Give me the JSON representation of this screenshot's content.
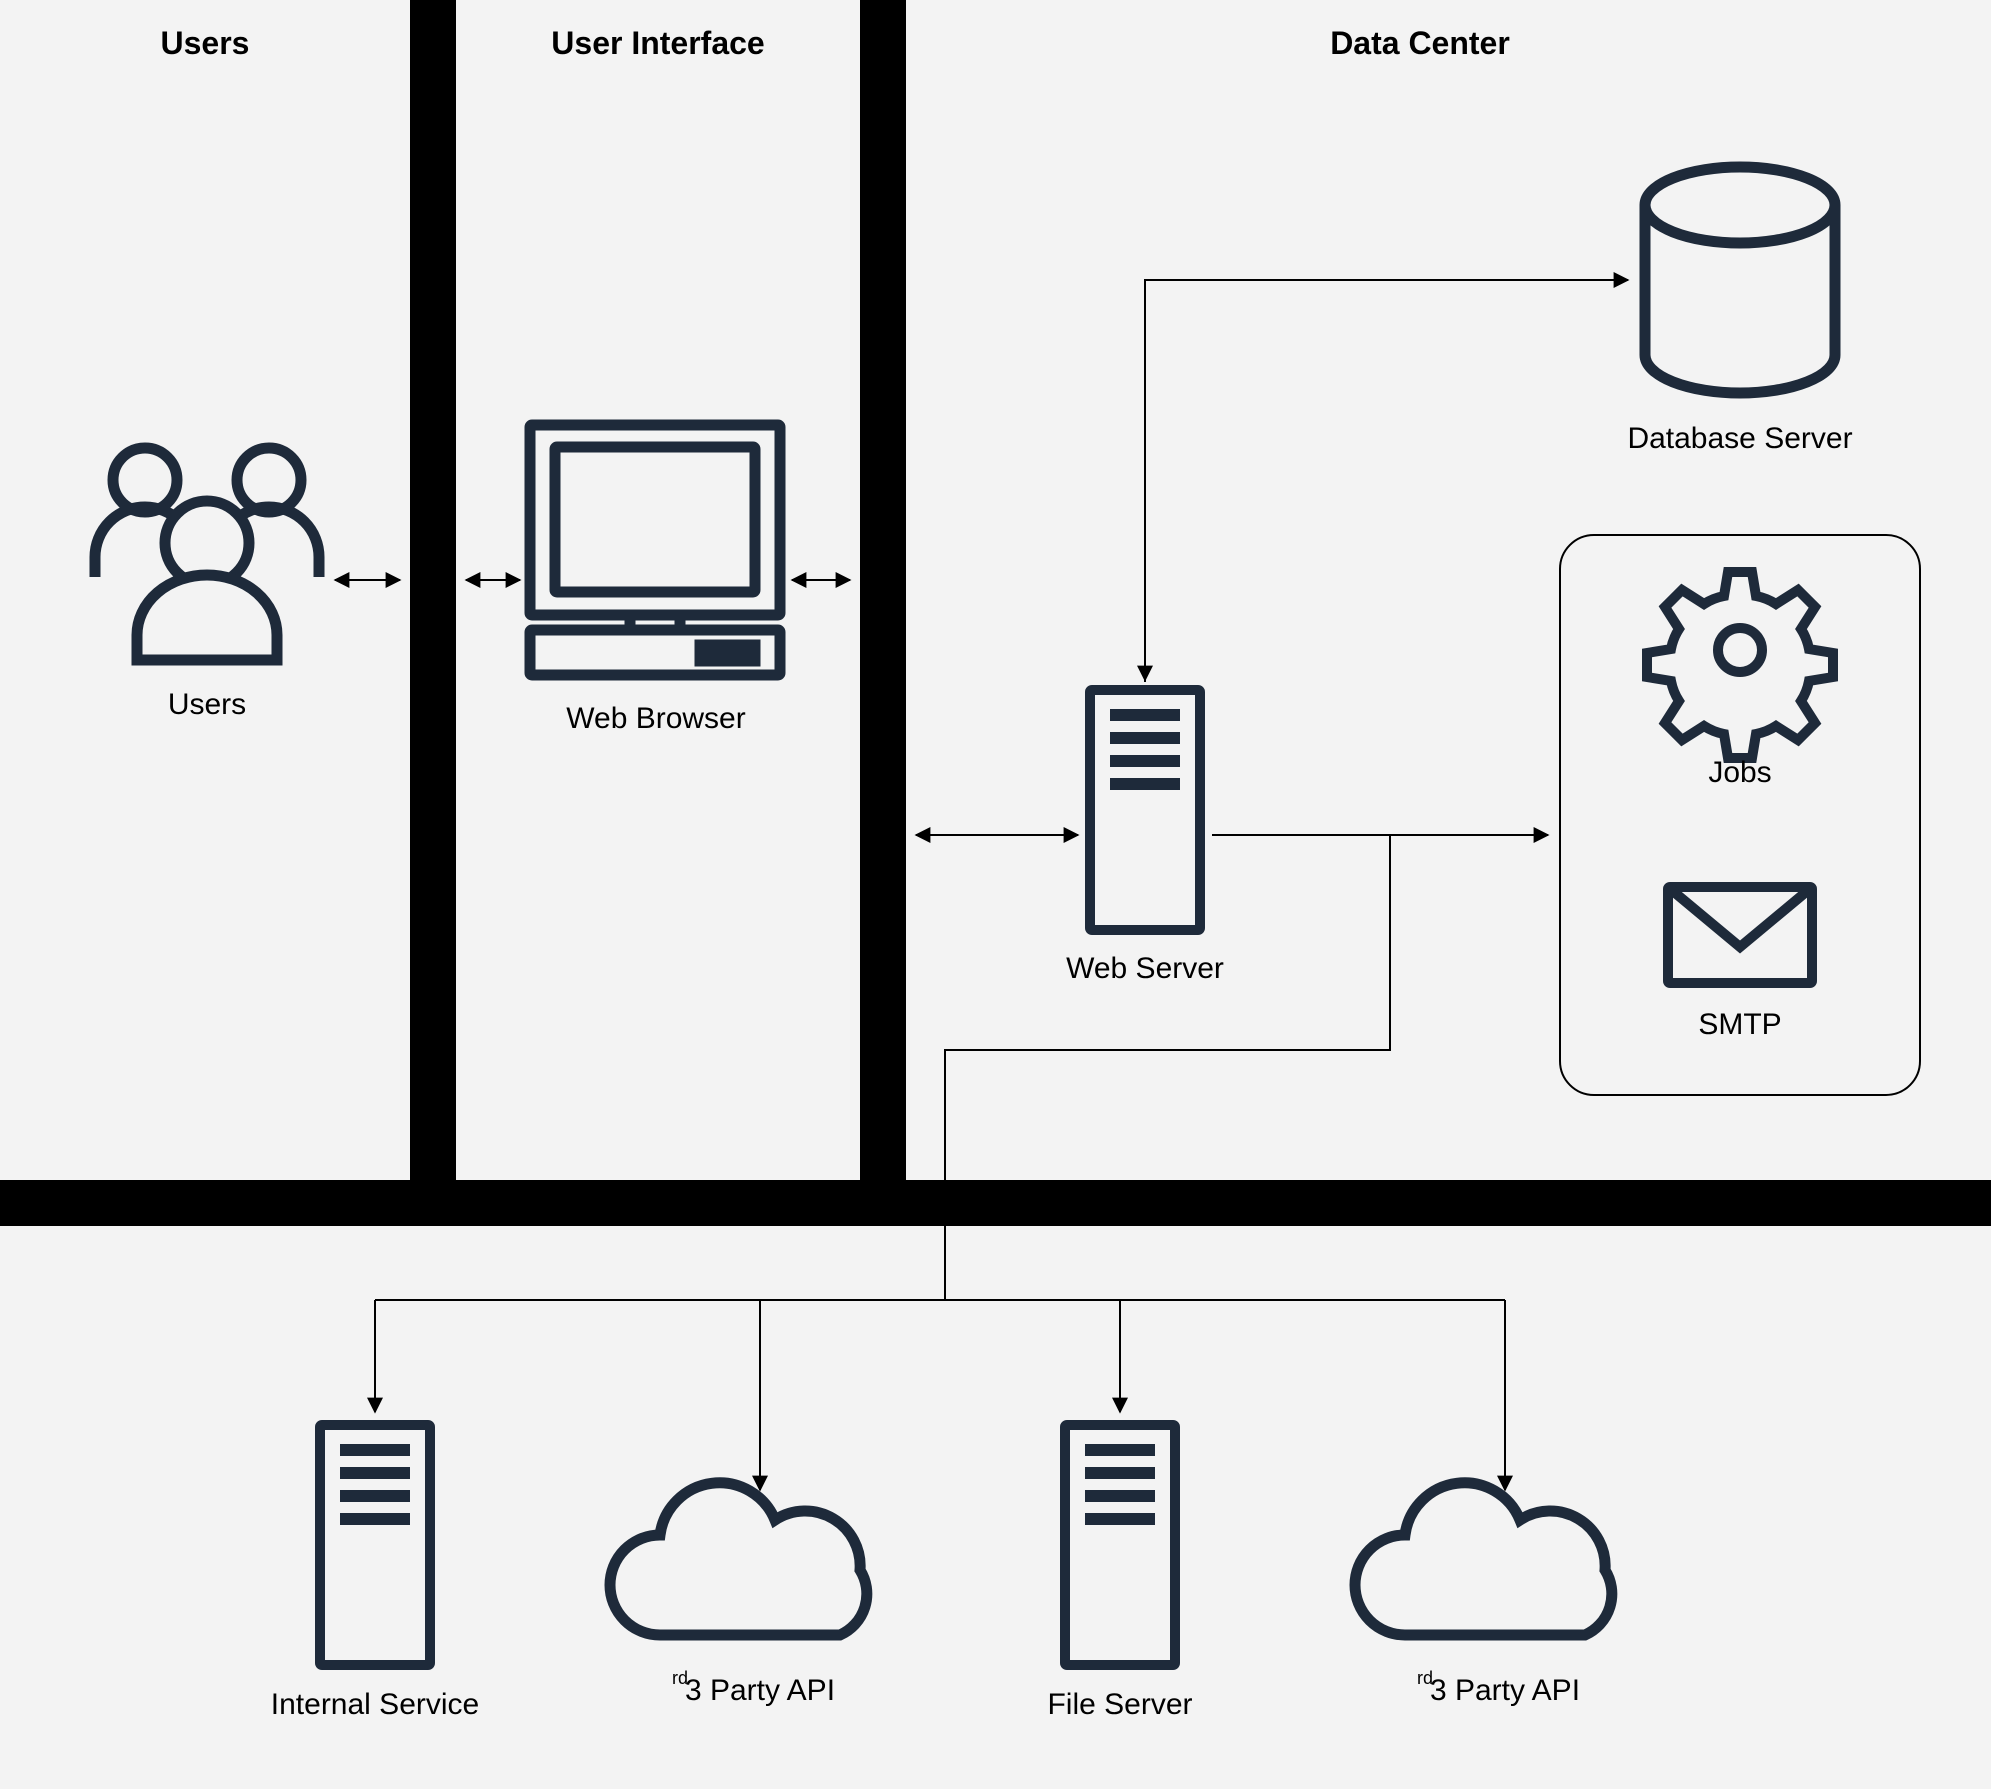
{
  "headers": {
    "users": "Users",
    "ui": "User Interface",
    "datacenter": "Data Center"
  },
  "nodes": {
    "users": "Users",
    "web_browser": "Web Browser",
    "web_server": "Web Server",
    "database_server": "Database Server",
    "jobs": "Jobs",
    "smtp": "SMTP",
    "internal_service": "Internal Service",
    "file_server": "File Server",
    "third_party_api": "3   Party API",
    "third_party_api_2": "3   Party API",
    "third_party_api_sup": "rd",
    "third_party_api_sup_2": "rd"
  },
  "colors": {
    "bg": "#f3f3f3",
    "ink": "#1e2a3a",
    "black": "#000000"
  }
}
